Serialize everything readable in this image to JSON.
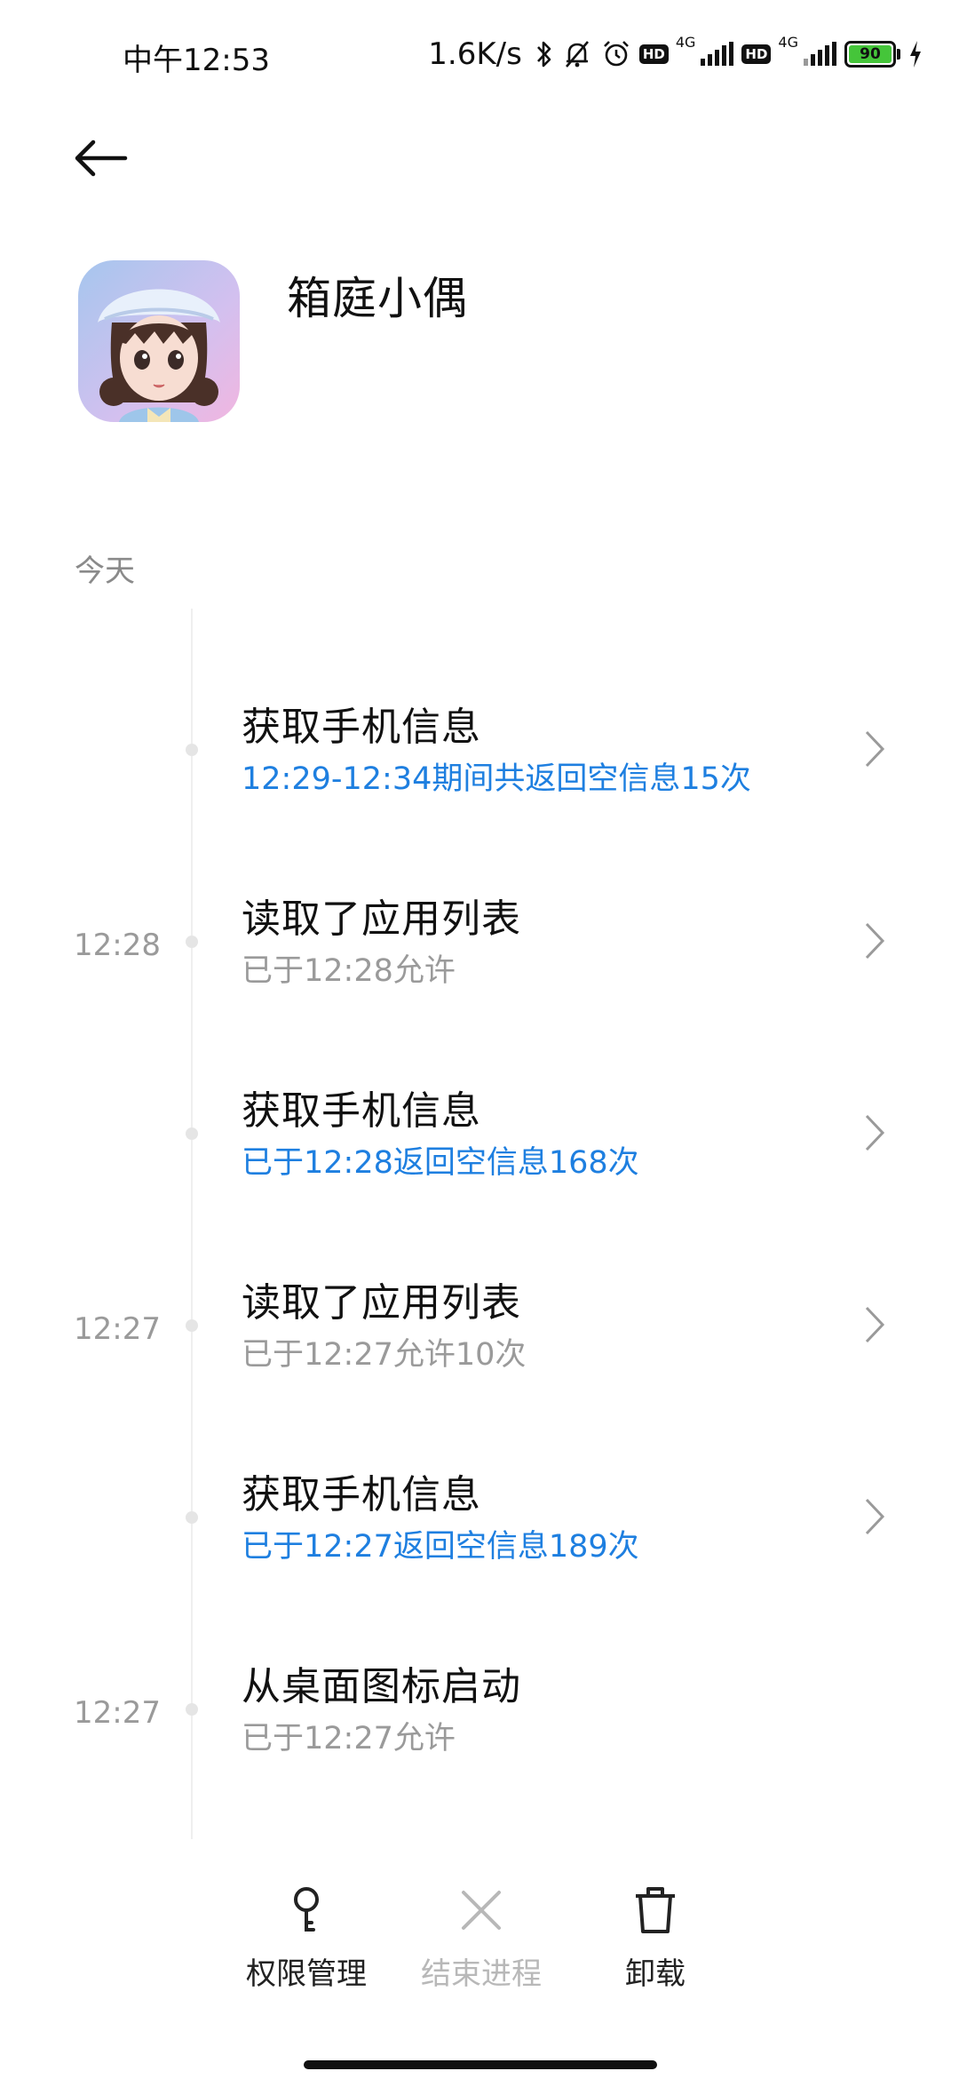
{
  "status_bar": {
    "time": "中午12:53",
    "net_speed": "1.6K/s",
    "hd_label": "HD",
    "net_type": "4G",
    "battery_level": "90",
    "battery_color": "#45c53a"
  },
  "header": {
    "back_icon": "arrow-left-icon"
  },
  "app": {
    "name": "箱庭小偶",
    "icon": "app-character-icon"
  },
  "section": {
    "label": "今天"
  },
  "events": [
    {
      "time": "",
      "title": "获取手机信息",
      "subtitle": "12:29-12:34期间共返回空信息15次",
      "subtitle_color": "#1e7fe0",
      "has_chevron": true
    },
    {
      "time": "12:28",
      "title": "读取了应用列表",
      "subtitle": "已于12:28允许",
      "subtitle_color": "#9a9a9a",
      "has_chevron": true
    },
    {
      "time": "",
      "title": "获取手机信息",
      "subtitle": "已于12:28返回空信息168次",
      "subtitle_color": "#1e7fe0",
      "has_chevron": true
    },
    {
      "time": "12:27",
      "title": "读取了应用列表",
      "subtitle": "已于12:27允许10次",
      "subtitle_color": "#9a9a9a",
      "has_chevron": true
    },
    {
      "time": "",
      "title": "获取手机信息",
      "subtitle": "已于12:27返回空信息189次",
      "subtitle_color": "#1e7fe0",
      "has_chevron": true
    },
    {
      "time": "12:27",
      "title": "从桌面图标启动",
      "subtitle": "已于12:27允许",
      "subtitle_color": "#9a9a9a",
      "has_chevron": false
    }
  ],
  "bottom_actions": [
    {
      "label": "权限管理",
      "icon": "key-icon",
      "enabled": true
    },
    {
      "label": "结束进程",
      "icon": "close-icon",
      "enabled": false
    },
    {
      "label": "卸载",
      "icon": "trash-icon",
      "enabled": true
    }
  ]
}
